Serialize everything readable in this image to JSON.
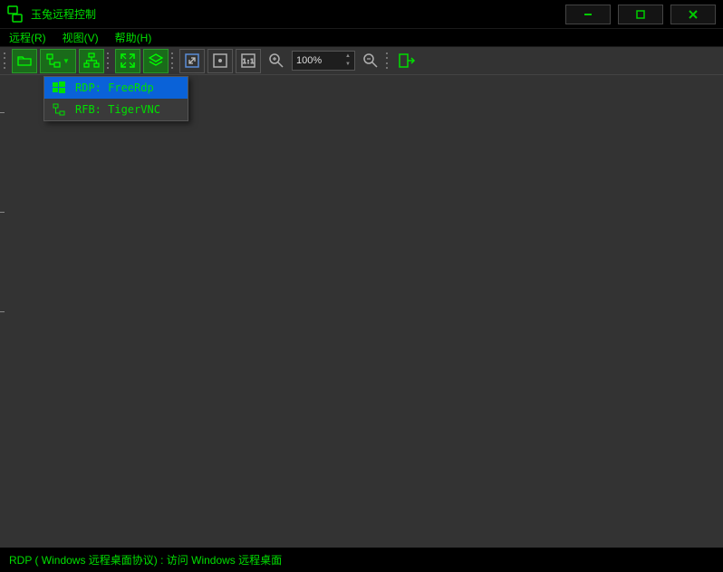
{
  "app": {
    "title": "玉兔远程控制"
  },
  "menu": {
    "remote": "远程(R)",
    "view": "视图(V)",
    "help": "帮助(H)"
  },
  "toolbar": {
    "zoom_value": "100%"
  },
  "dropdown": {
    "rdp": "RDP: FreeRdp",
    "rfb": "RFB: TigerVNC"
  },
  "status": {
    "text": "RDP ( Windows 远程桌面协议) : 访问 Windows 远程桌面"
  }
}
